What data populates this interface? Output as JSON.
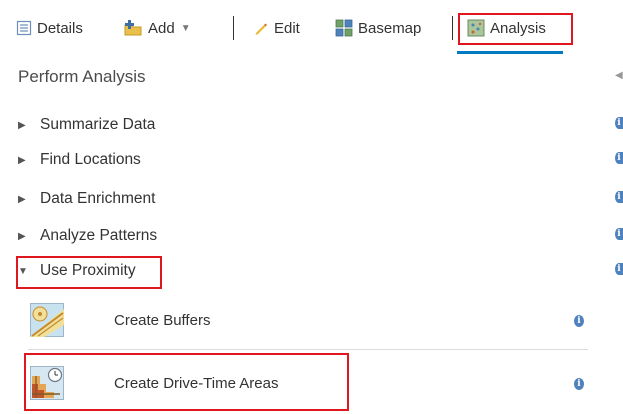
{
  "toolbar": {
    "details_label": "Details",
    "add_label": "Add",
    "edit_label": "Edit",
    "basemap_label": "Basemap",
    "analysis_label": "Analysis"
  },
  "panel": {
    "title": "Perform Analysis",
    "categories": [
      {
        "label": "Summarize Data",
        "expanded": false
      },
      {
        "label": "Find Locations",
        "expanded": false
      },
      {
        "label": "Data Enrichment",
        "expanded": false
      },
      {
        "label": "Analyze Patterns",
        "expanded": false
      },
      {
        "label": "Use Proximity",
        "expanded": true
      }
    ],
    "tools": [
      {
        "label": "Create Buffers",
        "icon": "create-buffers-icon"
      },
      {
        "label": "Create Drive-Time Areas",
        "icon": "drive-time-icon"
      }
    ]
  },
  "icons": {
    "details": "details-icon",
    "add": "add-icon",
    "edit": "pencil-icon",
    "basemap": "basemap-grid-icon",
    "analysis": "analysis-icon",
    "info": "info-icon"
  },
  "colors": {
    "highlight": "#e0171f",
    "active_tab": "#007ac2",
    "info": "#4f81bd"
  }
}
